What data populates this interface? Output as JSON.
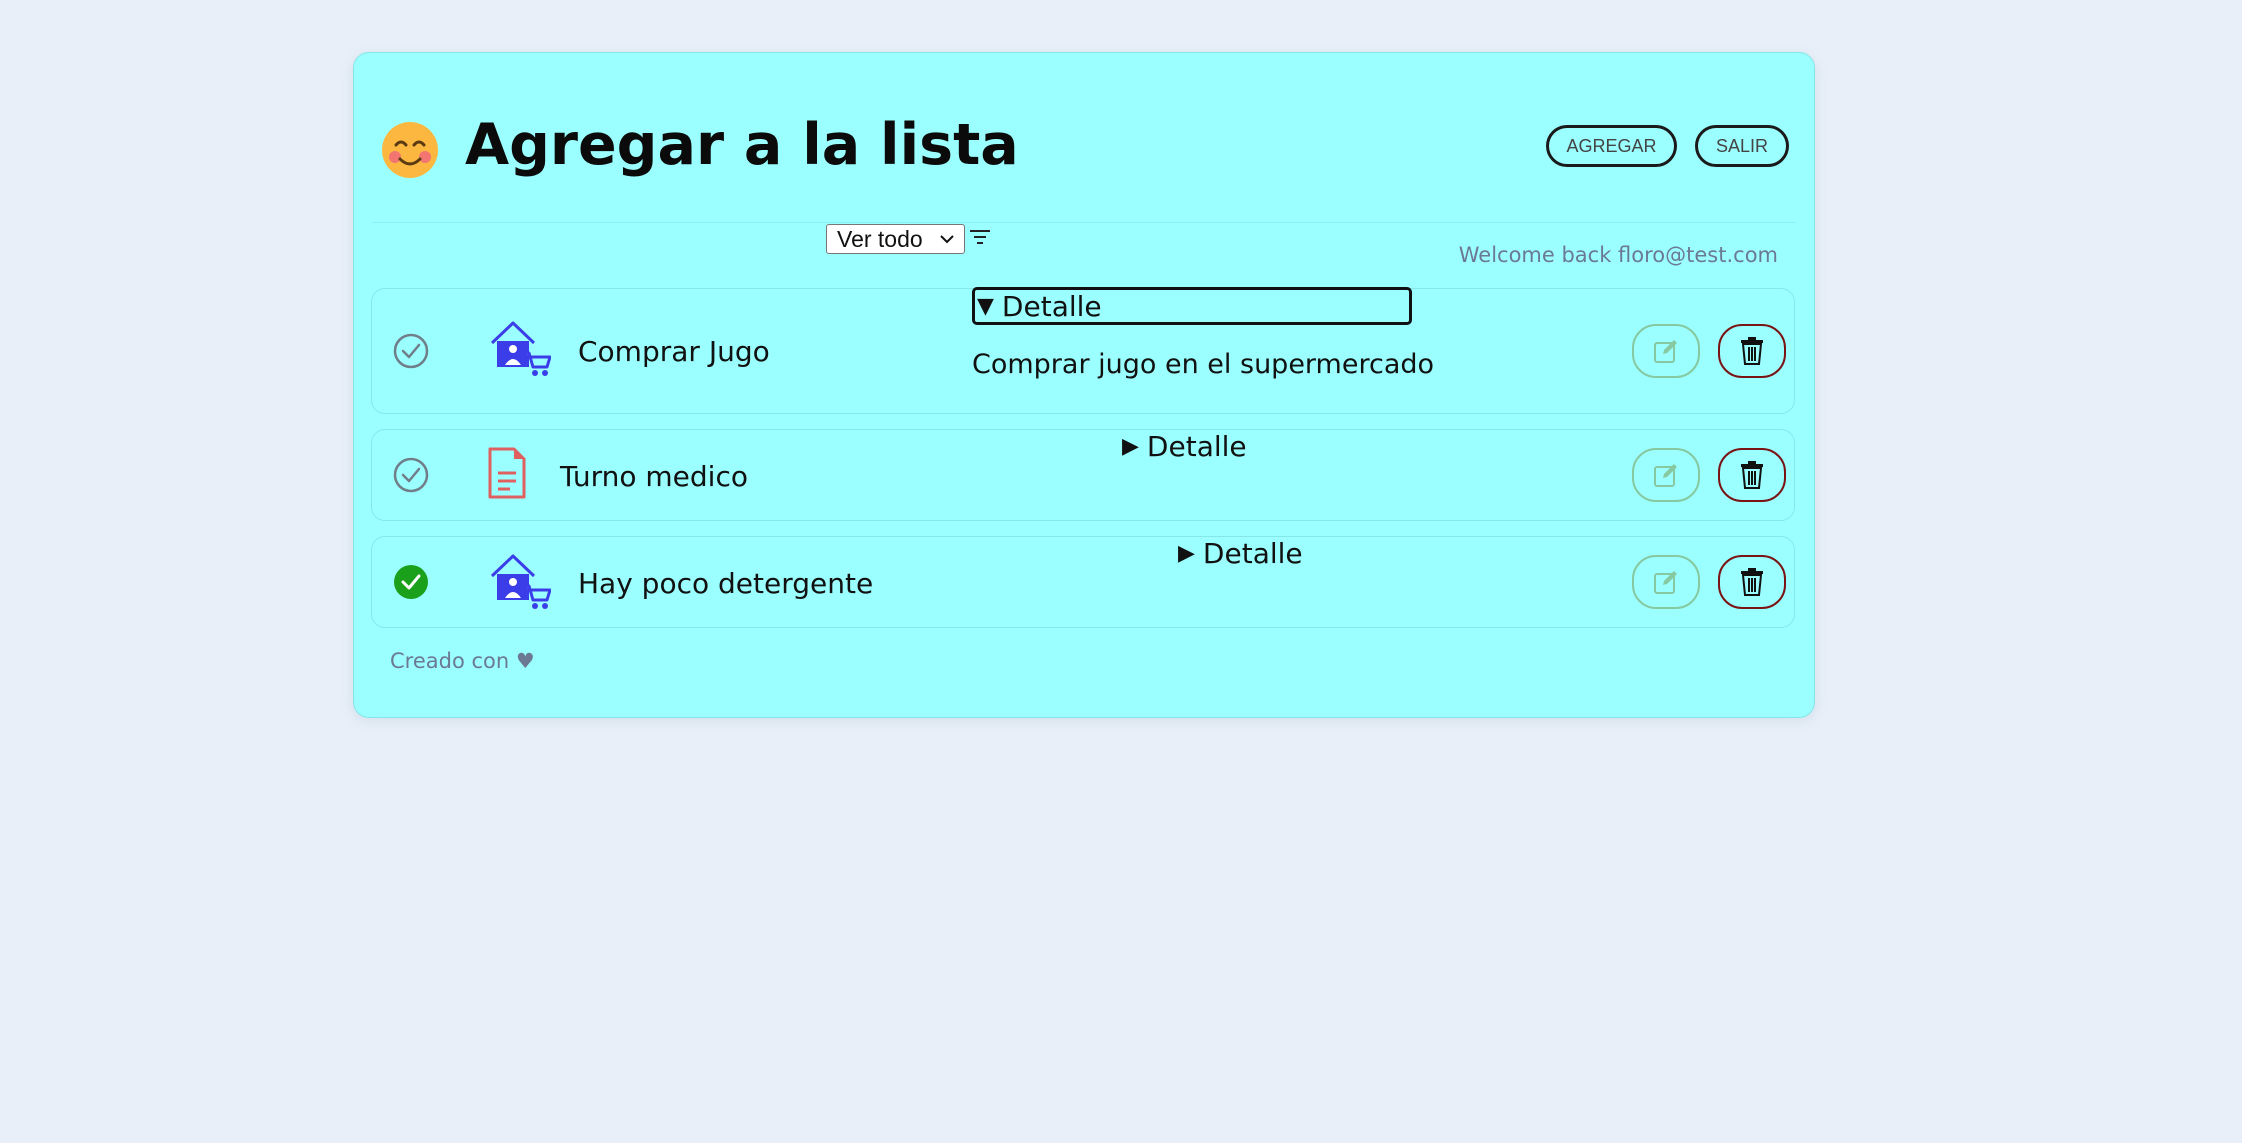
{
  "header": {
    "emoji_icon": "smiling-face-icon",
    "title": "Agregar a la lista",
    "add_button": "AGREGAR",
    "logout_button": "SALIR"
  },
  "filter": {
    "selected": "Ver todo",
    "icon": "filter-icon"
  },
  "welcome": "Welcome back floro@test.com",
  "tasks": [
    {
      "title": "Comprar Jugo",
      "category_icon": "house-cart-icon",
      "completed": false,
      "detail_label": "Detalle",
      "detail_expanded": true,
      "detail_text": "Comprar jugo en el supermercado"
    },
    {
      "title": "Turno medico",
      "category_icon": "document-icon",
      "completed": false,
      "detail_label": "Detalle",
      "detail_expanded": false
    },
    {
      "title": "Hay poco detergente",
      "category_icon": "house-cart-icon",
      "completed": true,
      "detail_label": "Detalle",
      "detail_expanded": false
    }
  ],
  "footer": "Creado con ♥",
  "colors": {
    "background": "#e8eff8",
    "card": "#9cffff",
    "completed_check": "#1aa01a",
    "category_blue": "#3b3ee8",
    "document_red": "#e06060",
    "delete_border": "#7a1414",
    "edit_border": "#86c8a0"
  }
}
